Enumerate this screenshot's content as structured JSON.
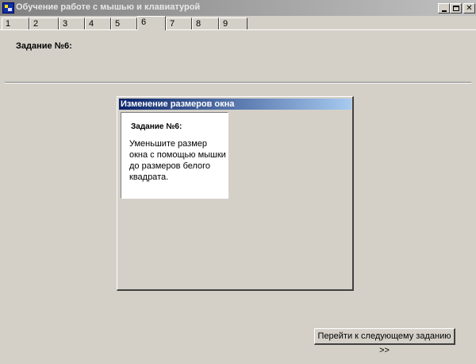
{
  "window": {
    "title": "Обучение работе с мышью и клавиатурой",
    "icon": "app-icon",
    "controls": {
      "minimize": "minimize-icon",
      "maximize": "maximize-icon",
      "close": "close-icon"
    }
  },
  "tabs": [
    {
      "label": "1",
      "active": false
    },
    {
      "label": "2",
      "active": false
    },
    {
      "label": "3",
      "active": false
    },
    {
      "label": "4",
      "active": false
    },
    {
      "label": "5",
      "active": false
    },
    {
      "label": "6",
      "active": true
    },
    {
      "label": "7",
      "active": false
    },
    {
      "label": "8",
      "active": false
    },
    {
      "label": "9",
      "active": false
    }
  ],
  "task_panel": {
    "title": "Задание №6:"
  },
  "child_window": {
    "title": "Изменение размеров окна",
    "box": {
      "title": "Задание №6:",
      "text": "Уменьшите размер окна с помощью мышки до размеров белого квадрата."
    }
  },
  "next_button": {
    "label": "Перейти к следующему заданию >>"
  }
}
